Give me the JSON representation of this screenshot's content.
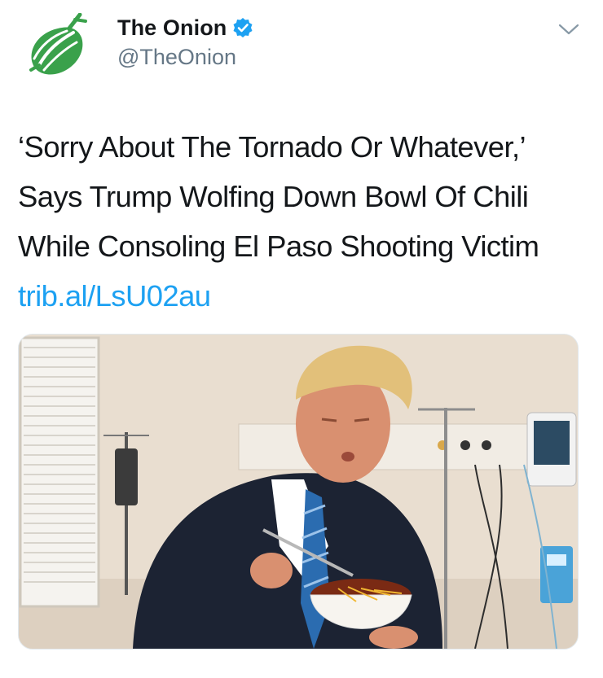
{
  "account": {
    "display_name": "The Onion",
    "handle": "@TheOnion",
    "verified": true,
    "avatar_icon": "onion-logo-icon",
    "brand_color": "#3aa14b"
  },
  "tweet": {
    "text": "‘Sorry About The Tornado Or Whatever,’ Says Trump Wolfing Down Bowl Of Chili While Consoling El Paso Shooting Victim",
    "link": "trib.al/LsU02au",
    "link_color": "#1da1f2"
  },
  "media": {
    "icon": "photo-image"
  },
  "menu": {
    "icon": "chevron-down-icon"
  }
}
